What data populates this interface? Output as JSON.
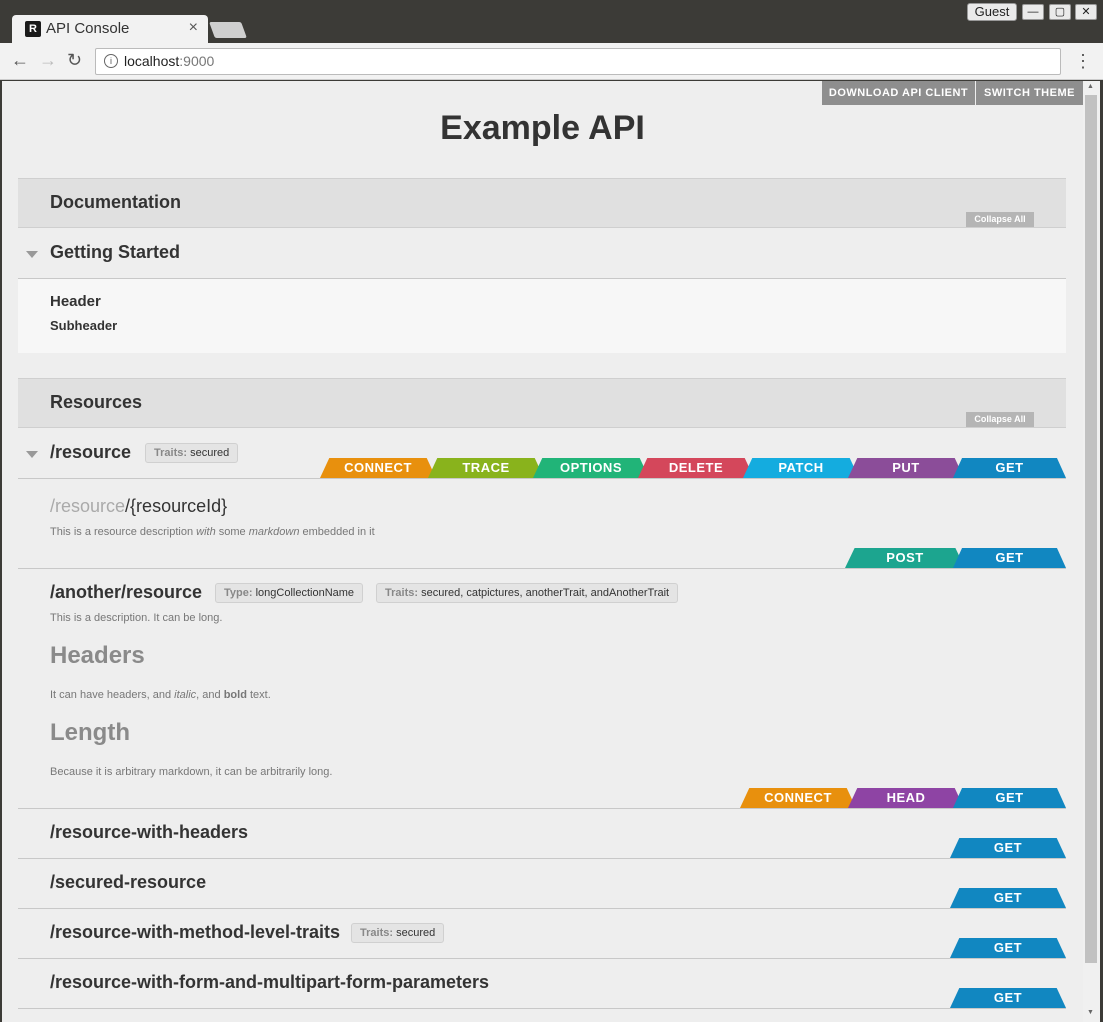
{
  "browser": {
    "tab_title": "API Console",
    "tab_favicon": "R",
    "close_glyph": "×",
    "guest_label": "Guest",
    "url_host": "localhost",
    "url_port": ":9000",
    "info_glyph": "i",
    "menu_glyph": "⋮",
    "back_glyph": "←",
    "forward_glyph": "→",
    "reload_glyph": "↻",
    "min_glyph": "—",
    "max_glyph": "▢",
    "close_win_glyph": "✕"
  },
  "topbar": {
    "download_label": "DOWNLOAD API CLIENT",
    "theme_label": "SWITCH THEME"
  },
  "page": {
    "title": "Example API"
  },
  "documentation": {
    "title": "Documentation",
    "collapse_label": "Collapse All",
    "item_title": "Getting Started",
    "header": "Header",
    "subheader": "Subheader"
  },
  "resources": {
    "title": "Resources",
    "collapse_label": "Collapse All",
    "r1": {
      "title": "/resource",
      "trait_label": "Traits:",
      "trait_value": "secured",
      "methods": [
        "CONNECT",
        "TRACE",
        "OPTIONS",
        "DELETE",
        "PATCH",
        "PUT",
        "GET"
      ]
    },
    "r1_sub": {
      "path_faded": "/resource",
      "path_rest": "/{resourceId}",
      "desc_a": "This is a resource description ",
      "desc_with": "with",
      "desc_b": " some ",
      "desc_markdown": "markdown",
      "desc_c": " embedded in it",
      "methods": [
        "POST",
        "GET"
      ]
    },
    "r2": {
      "title": "/another/resource",
      "type_label": "Type:",
      "type_value": "longCollectionName",
      "trait_label": "Traits:",
      "trait_value": "secured, catpictures, anotherTrait, andAnotherTrait",
      "desc": "This is a description. It can be long.",
      "h_headers": "Headers",
      "p1_a": "It can have headers, and ",
      "p1_italic": "italic",
      "p1_b": ", and ",
      "p1_bold": "bold",
      "p1_c": " text.",
      "h_length": "Length",
      "p2": "Because it is arbitrary markdown, it can be arbitrarily long.",
      "methods": [
        "CONNECT",
        "HEAD",
        "GET"
      ]
    },
    "r3": {
      "title": "/resource-with-headers",
      "method": "GET"
    },
    "r4": {
      "title": "/secured-resource",
      "method": "GET"
    },
    "r5": {
      "title": "/resource-with-method-level-traits",
      "trait_label": "Traits:",
      "trait_value": "secured",
      "method": "GET"
    },
    "r6": {
      "title": "/resource-with-form-and-multipart-form-parameters",
      "method": "GET"
    }
  }
}
